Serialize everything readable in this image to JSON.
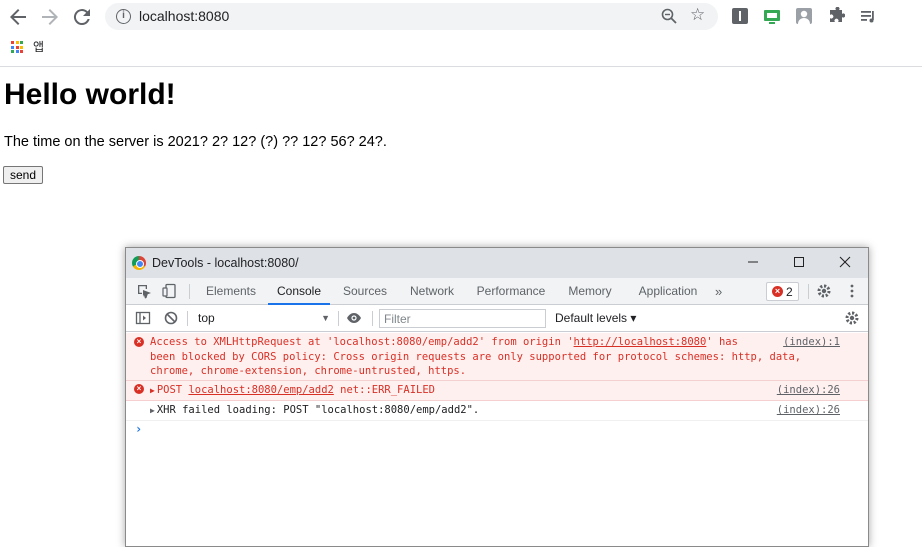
{
  "browser": {
    "url": "localhost:8080",
    "bookmarks": {
      "apps_label": "앱"
    },
    "icons": [
      "back-arrow-icon",
      "forward-arrow-icon",
      "reload-icon",
      "site-info-icon",
      "zoom-icon",
      "bookmark-star-icon",
      "extension-icon",
      "profile-avatar-icon",
      "puzzle-icon",
      "reading-list-icon"
    ]
  },
  "page": {
    "heading": "Hello world!",
    "paragraph": "The time on the server is 2021? 2? 12? (?) ?? 12? 56? 24?.",
    "send_label": "send"
  },
  "devtools": {
    "title": "DevTools - localhost:8080/",
    "tabs": [
      "Elements",
      "Console",
      "Sources",
      "Network",
      "Performance",
      "Memory",
      "Application"
    ],
    "active_tab": "Console",
    "more": "»",
    "error_count": "2",
    "context": "top",
    "filter_placeholder": "Filter",
    "levels": "Default levels ▾",
    "messages": [
      {
        "type": "error",
        "line1_pre": "Access to XMLHttpRequest at 'localhost:8080/emp/add2' from origin '",
        "line1_link": "http://localhost:8080",
        "line1_post": "' has",
        "line2": "been blocked by CORS policy: Cross origin requests are only supported for protocol schemes: http, data,",
        "line3": "chrome, chrome-extension, chrome-untrusted, https.",
        "source": "(index):1"
      },
      {
        "type": "error",
        "pre": "POST ",
        "link": "localhost:8080/emp/add2",
        "post": " net::ERR_FAILED",
        "source": "(index):26"
      },
      {
        "type": "info",
        "text": "XHR failed loading: POST \"localhost:8080/emp/add2\".",
        "source": "(index):26"
      }
    ],
    "prompt": "›"
  },
  "colors": {
    "error_red": "#d93025",
    "accent_blue": "#1a73e8",
    "error_bg": "#fff0f0"
  }
}
